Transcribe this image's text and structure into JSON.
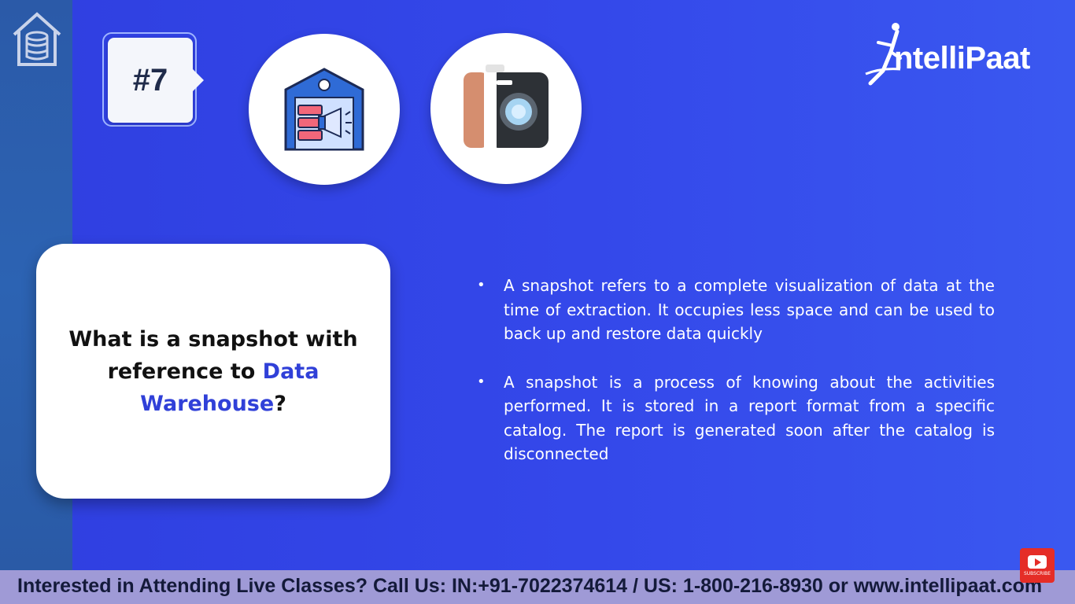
{
  "badge": {
    "number": "#7"
  },
  "brand": {
    "logo_text": "ntelliPaat"
  },
  "question": {
    "part1": "What is a snapshot with reference to ",
    "highlight": "Data Warehouse",
    "part2": "?"
  },
  "bullets": [
    "A snapshot refers to a complete visualization of data at the time of extraction. It occupies less space and can be used to back up and restore data quickly",
    "A snapshot is a process of knowing about the activities performed. It is stored in a report format from a specific catalog. The report is generated soon after the catalog is disconnected"
  ],
  "footer": {
    "text": "Interested in Attending Live Classes? Call Us: IN:+91-7022374614 / US: 1-800-216-8930 or www.intellipaat.com"
  },
  "youtube": {
    "label": "SUBSCRIBE"
  },
  "icons": {
    "database": "database-icon",
    "warehouse": "warehouse-icon",
    "camera": "camera-icon",
    "youtube": "youtube-icon"
  },
  "colors": {
    "background": "#3448ea",
    "highlight": "#3040d8",
    "footer": "#9f9ad6"
  }
}
